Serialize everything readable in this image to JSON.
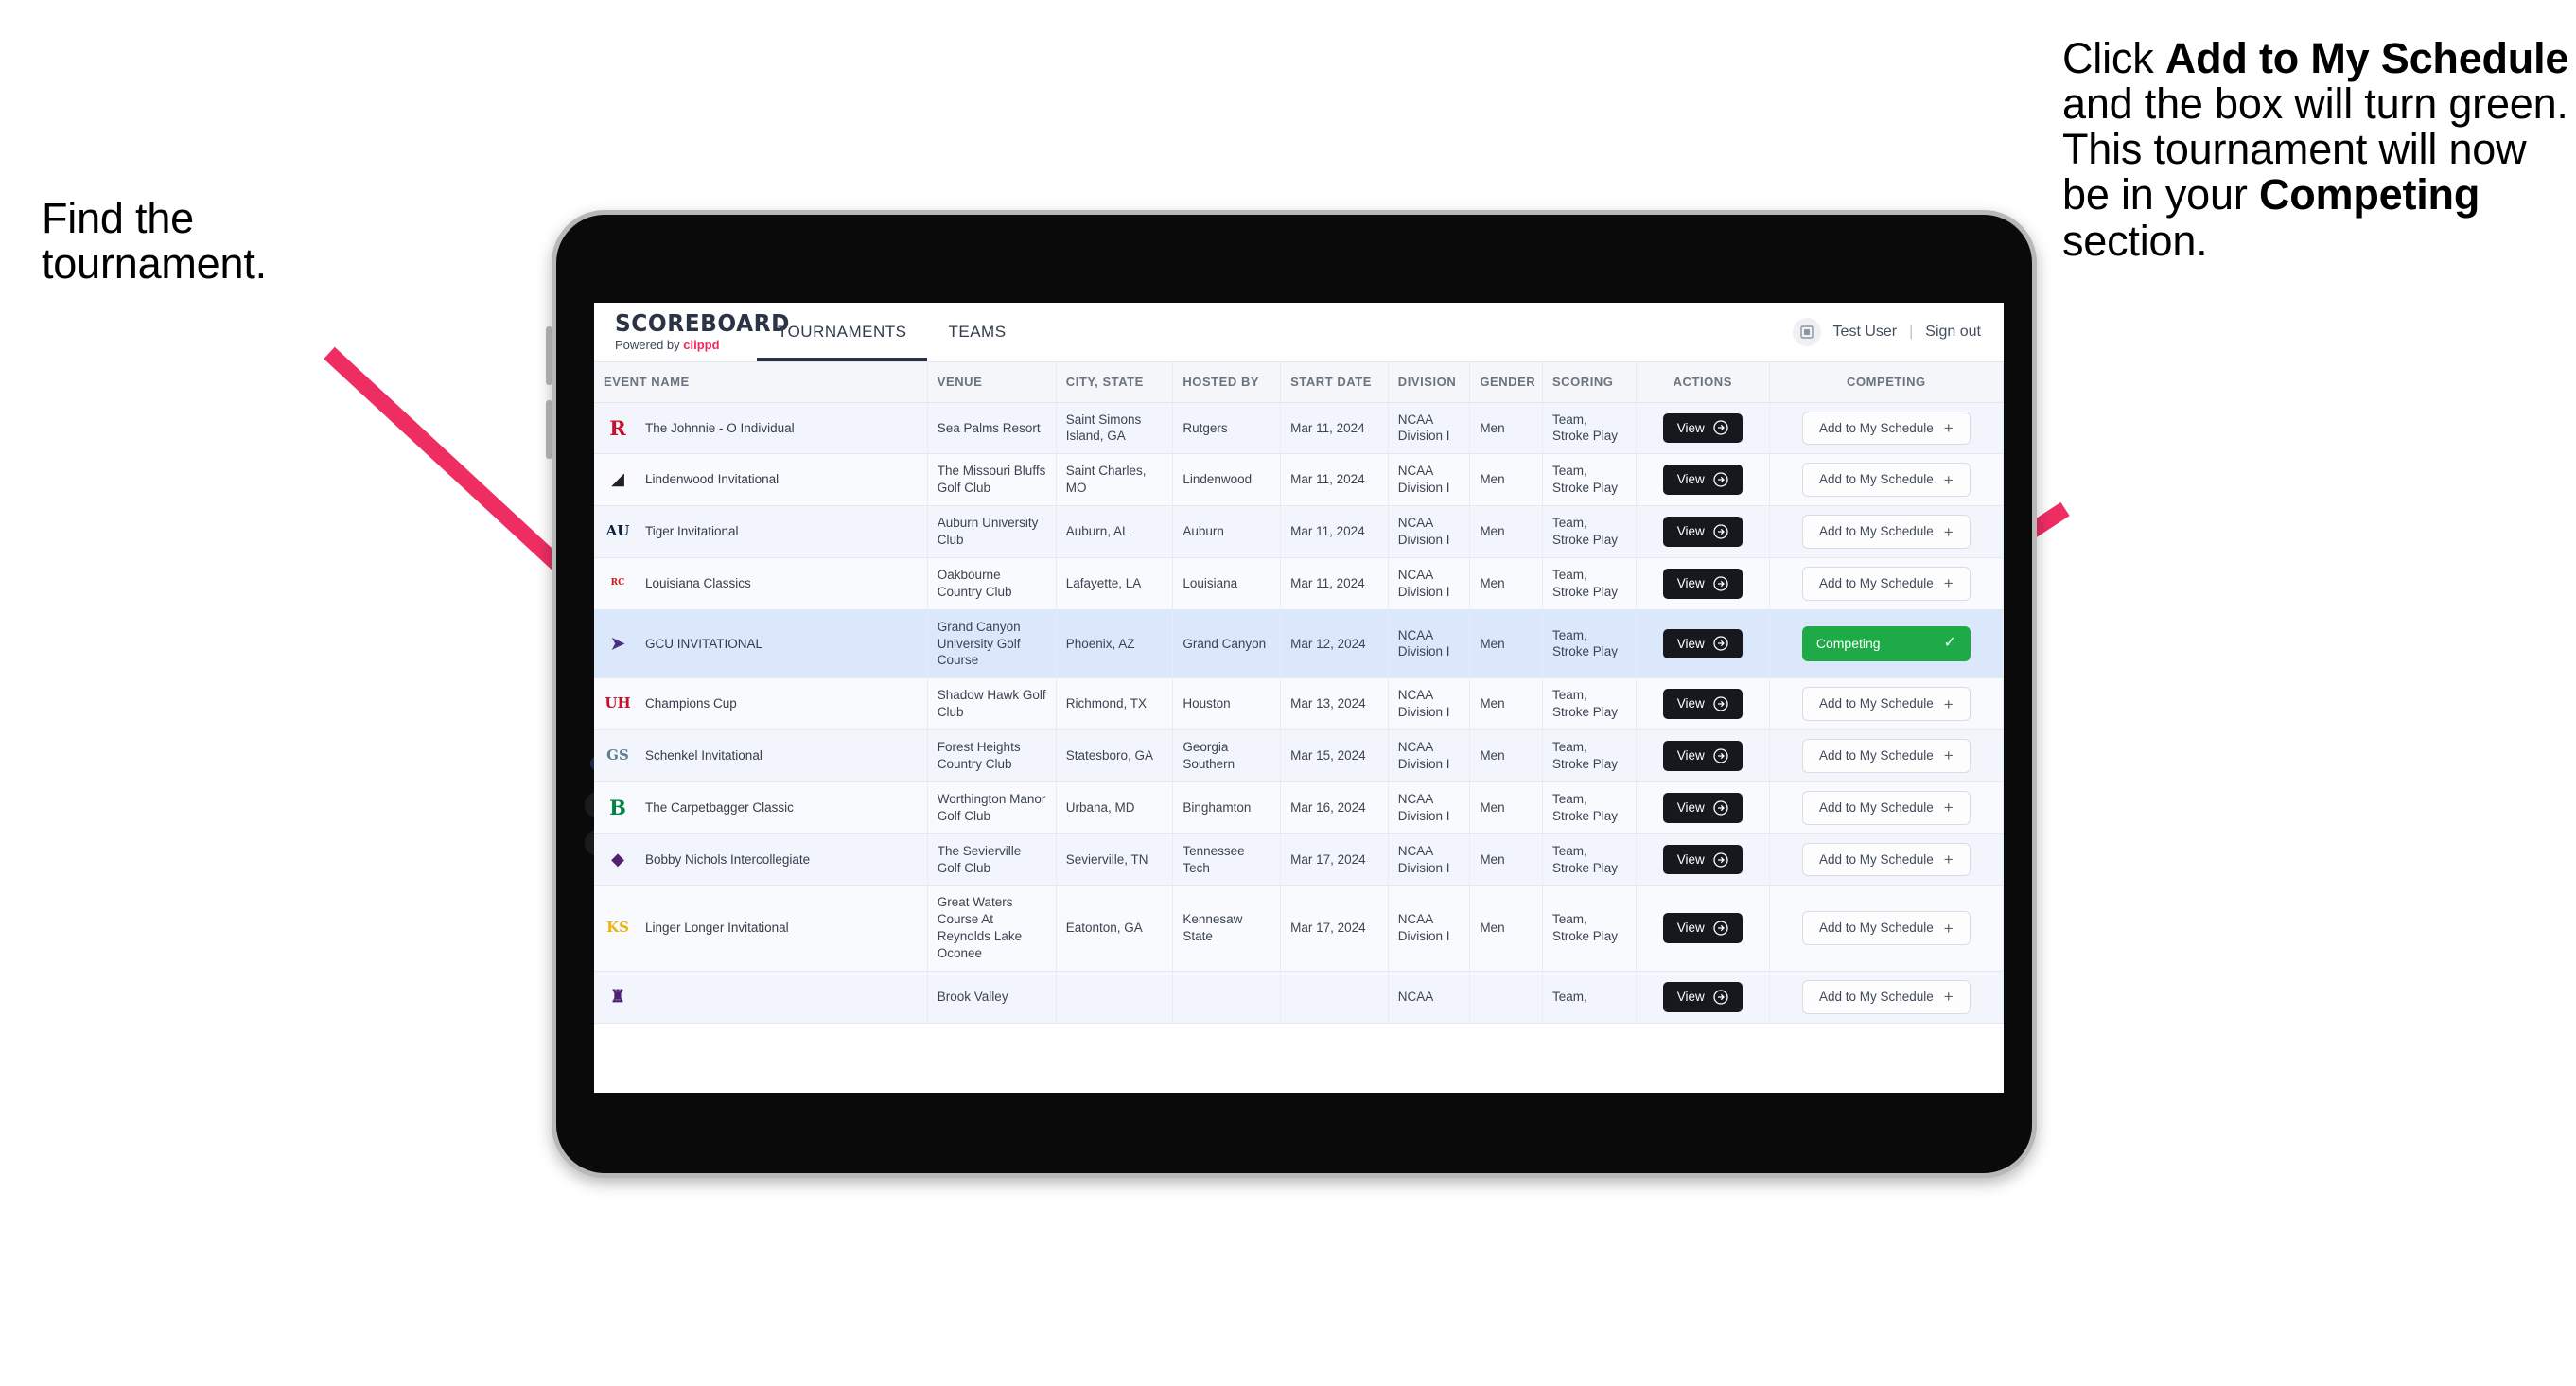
{
  "annotations": {
    "left": {
      "lines": [
        "Find the",
        "tournament."
      ]
    },
    "right": {
      "segments": [
        {
          "text": "Click ",
          "bold": false
        },
        {
          "text": "Add to My Schedule",
          "bold": true
        },
        {
          "text": " and the box will turn green. This tournament will now be in your ",
          "bold": false
        },
        {
          "text": "Competing",
          "bold": true
        },
        {
          "text": " section.",
          "bold": false
        }
      ]
    },
    "arrow_color": "#ee2d63"
  },
  "app": {
    "brand": {
      "title": "SCOREBOARD",
      "powered_prefix": "Powered by ",
      "powered_name": "clippd"
    },
    "nav": [
      {
        "label": "TOURNAMENTS",
        "active": true
      },
      {
        "label": "TEAMS",
        "active": false
      }
    ],
    "account": {
      "name": "Test User",
      "separator": "|",
      "signout": "Sign out",
      "avatar_icon": "user-placeholder-icon"
    },
    "table": {
      "columns": [
        "EVENT NAME",
        "VENUE",
        "CITY, STATE",
        "HOSTED BY",
        "START DATE",
        "DIVISION",
        "GENDER",
        "SCORING",
        "ACTIONS",
        "COMPETING"
      ],
      "view_label": "View",
      "add_label": "Add to My Schedule",
      "competing_label": "Competing",
      "rows": [
        {
          "event": "The Johnnie - O Individual",
          "venue": "Sea Palms Resort",
          "city": "Saint Simons Island, GA",
          "host": "Rutgers",
          "date": "Mar 11, 2024",
          "division": "NCAA Division I",
          "gender": "Men",
          "scoring": "Team, Stroke Play",
          "competing": false,
          "logo": {
            "text": "R",
            "color": "#c8102e",
            "kind": "letter"
          }
        },
        {
          "event": "Lindenwood Invitational",
          "venue": "The Missouri Bluffs Golf Club",
          "city": "Saint Charles, MO",
          "host": "Lindenwood",
          "date": "Mar 11, 2024",
          "division": "NCAA Division I",
          "gender": "Men",
          "scoring": "Team, Stroke Play",
          "competing": false,
          "logo": {
            "text": "◢",
            "color": "#231f20",
            "kind": "shape"
          }
        },
        {
          "event": "Tiger Invitational",
          "venue": "Auburn University Club",
          "city": "Auburn, AL",
          "host": "Auburn",
          "date": "Mar 11, 2024",
          "division": "NCAA Division I",
          "gender": "Men",
          "scoring": "Team, Stroke Play",
          "competing": false,
          "logo": {
            "text": "AU",
            "color": "#0c2340",
            "kind": "letter-sm"
          }
        },
        {
          "event": "Louisiana Classics",
          "venue": "Oakbourne Country Club",
          "city": "Lafayette, LA",
          "host": "Louisiana",
          "date": "Mar 11, 2024",
          "division": "NCAA Division I",
          "gender": "Men",
          "scoring": "Team, Stroke Play",
          "competing": false,
          "logo": {
            "text": "RC",
            "color": "#ce181e",
            "kind": "badge"
          }
        },
        {
          "event": "GCU INVITATIONAL",
          "venue": "Grand Canyon University Golf Course",
          "city": "Phoenix, AZ",
          "host": "Grand Canyon",
          "date": "Mar 12, 2024",
          "division": "NCAA Division I",
          "gender": "Men",
          "scoring": "Team, Stroke Play",
          "competing": true,
          "logo": {
            "text": "➤",
            "color": "#4f2d7f",
            "kind": "shape"
          }
        },
        {
          "event": "Champions Cup",
          "venue": "Shadow Hawk Golf Club",
          "city": "Richmond, TX",
          "host": "Houston",
          "date": "Mar 13, 2024",
          "division": "NCAA Division I",
          "gender": "Men",
          "scoring": "Team, Stroke Play",
          "competing": false,
          "logo": {
            "text": "UH",
            "color": "#c8102e",
            "kind": "letter-sm"
          }
        },
        {
          "event": "Schenkel Invitational",
          "venue": "Forest Heights Country Club",
          "city": "Statesboro, GA",
          "host": "Georgia Southern",
          "date": "Mar 15, 2024",
          "division": "NCAA Division I",
          "gender": "Men",
          "scoring": "Team, Stroke Play",
          "competing": false,
          "logo": {
            "text": "GS",
            "color": "#5b7f95",
            "kind": "letter-sm"
          }
        },
        {
          "event": "The Carpetbagger Classic",
          "venue": "Worthington Manor Golf Club",
          "city": "Urbana, MD",
          "host": "Binghamton",
          "date": "Mar 16, 2024",
          "division": "NCAA Division I",
          "gender": "Men",
          "scoring": "Team, Stroke Play",
          "competing": false,
          "logo": {
            "text": "B",
            "color": "#00843d",
            "kind": "letter"
          }
        },
        {
          "event": "Bobby Nichols Intercollegiate",
          "venue": "The Sevierville Golf Club",
          "city": "Sevierville, TN",
          "host": "Tennessee Tech",
          "date": "Mar 17, 2024",
          "division": "NCAA Division I",
          "gender": "Men",
          "scoring": "Team, Stroke Play",
          "competing": false,
          "logo": {
            "text": "◆",
            "color": "#4f2170",
            "kind": "shape"
          }
        },
        {
          "event": "Linger Longer Invitational",
          "venue": "Great Waters Course At Reynolds Lake Oconee",
          "city": "Eatonton, GA",
          "host": "Kennesaw State",
          "date": "Mar 17, 2024",
          "division": "NCAA Division I",
          "gender": "Men",
          "scoring": "Team, Stroke Play",
          "competing": false,
          "logo": {
            "text": "KS",
            "color": "#eeb211",
            "kind": "letter-sm"
          }
        },
        {
          "event": "",
          "venue": "Brook Valley",
          "city": "",
          "host": "",
          "date": "",
          "division": "NCAA",
          "gender": "",
          "scoring": "Team,",
          "competing": false,
          "partial": true,
          "logo": {
            "text": "♜",
            "color": "#4f2170",
            "kind": "shape"
          }
        }
      ]
    }
  }
}
